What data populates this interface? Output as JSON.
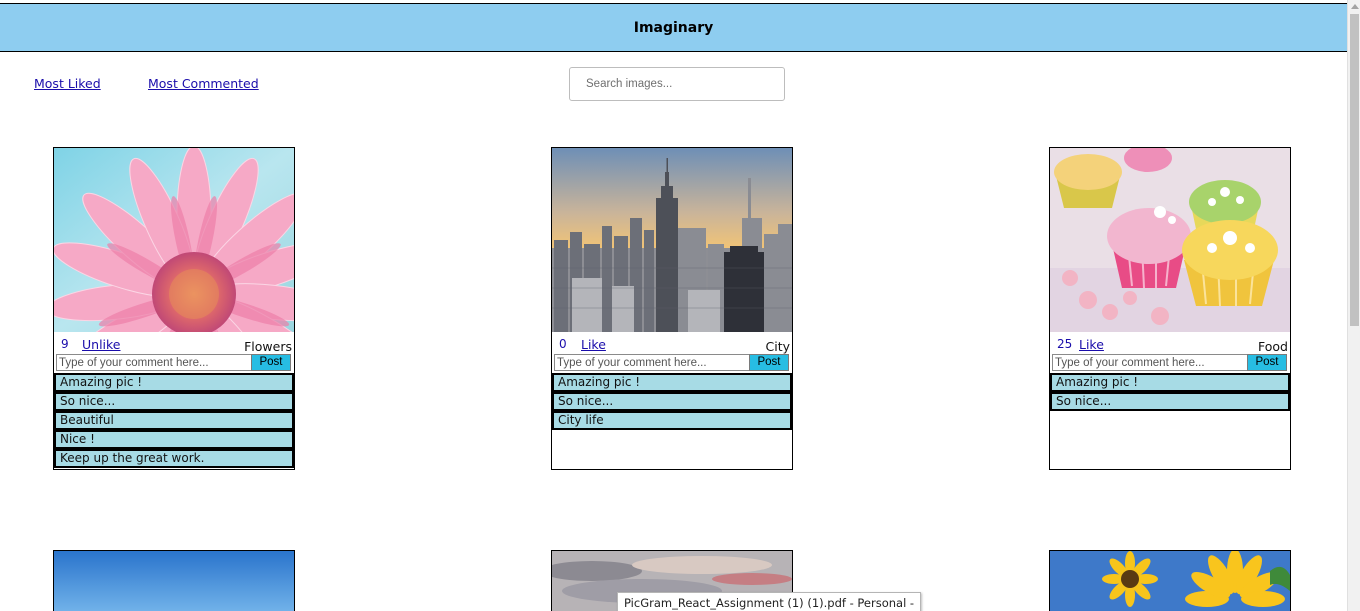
{
  "header": {
    "title": "Imaginary",
    "bg_color": "#8ecdf0"
  },
  "nav": {
    "most_liked": "Most Liked",
    "most_commented": "Most Commented"
  },
  "search": {
    "placeholder": "Search images...",
    "value": ""
  },
  "comment_placeholder": "Type of your comment here...",
  "post_label": "Post",
  "cards": [
    {
      "likes": "9",
      "like_label": "Unlike",
      "category": "Flowers",
      "image": "pink-daisy",
      "comments": [
        "Amazing pic !",
        "So nice...",
        "Beautiful",
        "Nice !",
        "Keep up the great work."
      ]
    },
    {
      "likes": "0",
      "like_label": "Like",
      "category": "City",
      "image": "city-skyline",
      "comments": [
        "Amazing pic !",
        "So nice...",
        "City life"
      ]
    },
    {
      "likes": "25",
      "like_label": "Like",
      "category": "Food",
      "image": "cupcakes",
      "comments": [
        "Amazing pic !",
        "So nice..."
      ]
    }
  ],
  "row2_images": [
    "blue-sky",
    "cloudy-sky",
    "sunflowers"
  ],
  "tooltip": {
    "text": "PicGram_React_Assignment (1) (1).pdf - Personal -"
  },
  "colors": {
    "comment_bg": "#a7dbe5",
    "post_button": "#27bde3",
    "link": "#1a0dab"
  }
}
